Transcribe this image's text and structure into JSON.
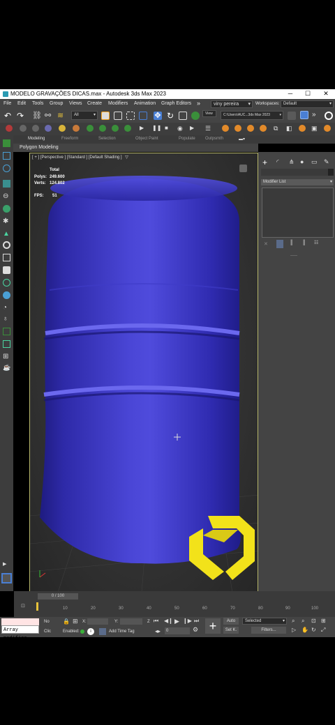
{
  "window": {
    "title": "MODELO GRAVAÇÕES DICAS.max - Autodesk 3ds Max 2023",
    "minimize": "─",
    "maximize": "☐",
    "close": "✕"
  },
  "menu": {
    "items": [
      "File",
      "Edit",
      "Tools",
      "Group",
      "Views",
      "Create",
      "Modifiers",
      "Animation",
      "Graph Editors"
    ],
    "more": "»",
    "user": "viny pereira",
    "workspaces_label": "Workspaces:",
    "workspace": "Default"
  },
  "toolbar": {
    "selection_filter": "All",
    "view_label": "View",
    "path": "C:\\Users\\AUC...3ds Max 2023",
    "more": "»"
  },
  "ribbon": {
    "tabs": [
      "Modeling",
      "Freeform",
      "Selection",
      "Object Paint",
      "Populate",
      "Outpsmth"
    ],
    "panel_label": "Polygon Modeling"
  },
  "viewport": {
    "label": "[ + ] [Perspective ] [Standard ] [Default Shading ]",
    "stats": {
      "total_label": "Total",
      "polys_label": "Polys:",
      "polys_value": "249.600",
      "verts_label": "Verts:",
      "verts_value": "124.802",
      "fps_label": "FPS:",
      "fps_value": "51"
    },
    "object_color": "#3532c6"
  },
  "command_panel": {
    "modifier_list": "Modifier List"
  },
  "timeline": {
    "frame": "0 / 100",
    "ticks": [
      "10",
      "20",
      "30",
      "40",
      "50",
      "60",
      "70",
      "80",
      "90",
      "100"
    ]
  },
  "statusbar": {
    "maxscript": "Array modifier",
    "no_label": "No",
    "click_label": "Clic",
    "x_label": "X:",
    "y_label": "Y:",
    "z_label": "Z",
    "enabled_label": "Enabled:",
    "add_time_tag": "Add Time Tag",
    "auto": "Auto",
    "selected": "Selected",
    "set_k": "Set K.",
    "filters": "Filters...",
    "frame_field": "0"
  },
  "colors": {
    "ui_bg": "#444444",
    "viewport_border": "#b7b76a",
    "logo_yellow": "#f2e21a",
    "accent_blue": "#4a7fd4"
  }
}
